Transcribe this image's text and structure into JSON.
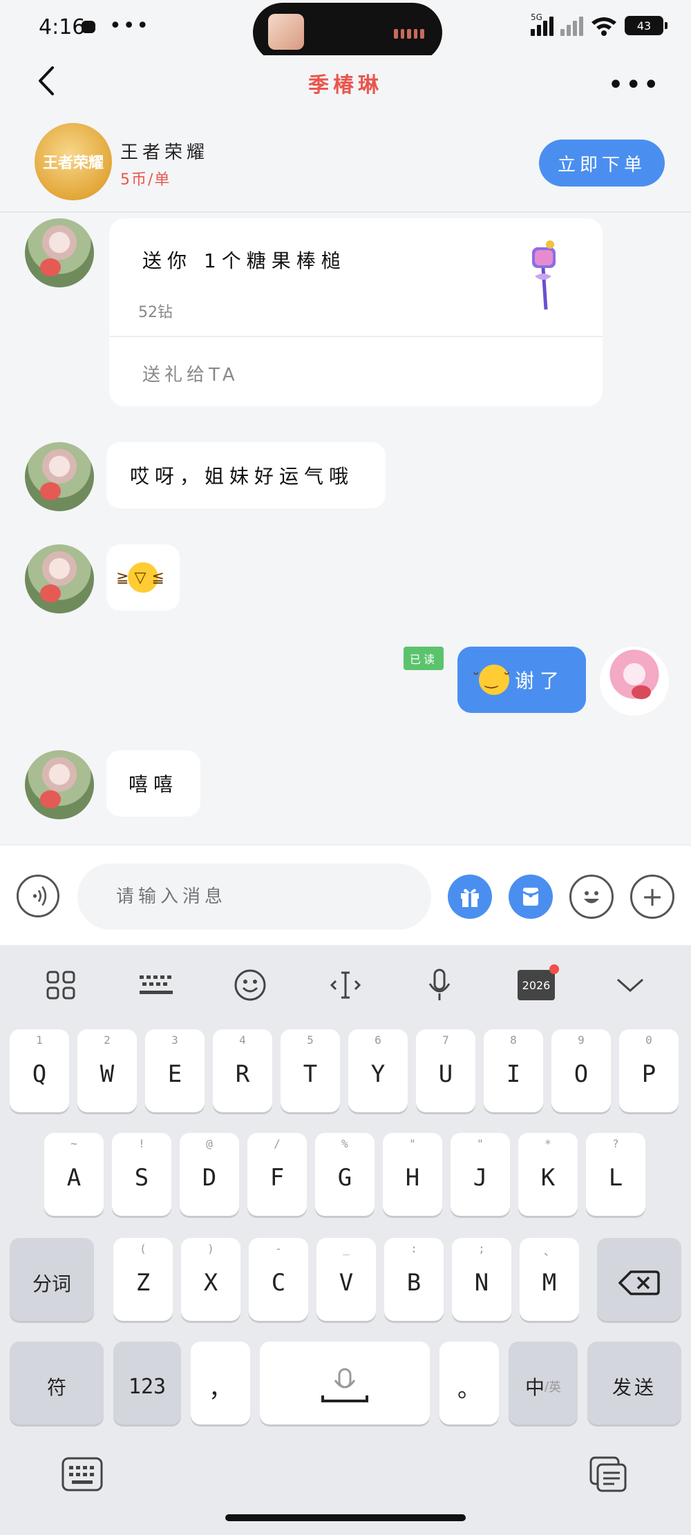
{
  "status_bar": {
    "time": "4:16",
    "network": "5G",
    "battery": "43"
  },
  "nav": {
    "title": "季椿琳"
  },
  "game_card": {
    "name": "王者荣耀",
    "price": "5币/单",
    "logo_text": "王者荣耀",
    "order_button": "立即下单"
  },
  "messages": {
    "gift": {
      "title": "送你 1个糖果棒槌",
      "price": "52钻",
      "send_link": "送礼给TA"
    },
    "msg1": "哎呀，姐妹好运气哦",
    "msg3": "谢了",
    "msg4": "嘻嘻",
    "read_status": "已读"
  },
  "input": {
    "placeholder": "请输入消息"
  },
  "keyboard": {
    "toolbar_date": "2026",
    "row1": [
      {
        "k": "Q",
        "h": "1"
      },
      {
        "k": "W",
        "h": "2"
      },
      {
        "k": "E",
        "h": "3"
      },
      {
        "k": "R",
        "h": "4"
      },
      {
        "k": "T",
        "h": "5"
      },
      {
        "k": "Y",
        "h": "6"
      },
      {
        "k": "U",
        "h": "7"
      },
      {
        "k": "I",
        "h": "8"
      },
      {
        "k": "O",
        "h": "9"
      },
      {
        "k": "P",
        "h": "0"
      }
    ],
    "row2": [
      {
        "k": "A",
        "h": "~"
      },
      {
        "k": "S",
        "h": "!"
      },
      {
        "k": "D",
        "h": "@"
      },
      {
        "k": "F",
        "h": "/"
      },
      {
        "k": "G",
        "h": "%"
      },
      {
        "k": "H",
        "h": "\""
      },
      {
        "k": "J",
        "h": "\""
      },
      {
        "k": "K",
        "h": "*"
      },
      {
        "k": "L",
        "h": "?"
      }
    ],
    "row3": [
      {
        "k": "Z",
        "h": "("
      },
      {
        "k": "X",
        "h": ")"
      },
      {
        "k": "C",
        "h": "-"
      },
      {
        "k": "V",
        "h": "_"
      },
      {
        "k": "B",
        "h": ":"
      },
      {
        "k": "N",
        "h": ";"
      },
      {
        "k": "M",
        "h": "、"
      }
    ],
    "fenci": "分词",
    "symbols": "符",
    "numbers": "123",
    "comma": "，",
    "period": "。",
    "lang": "中",
    "lang_alt": "英",
    "send": "发送"
  }
}
